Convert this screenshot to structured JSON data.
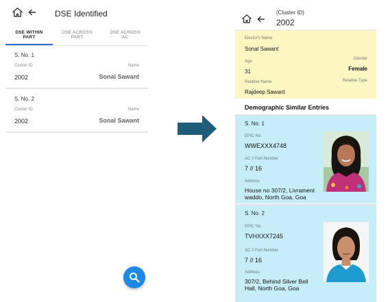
{
  "left": {
    "title": "DSE Identified",
    "tabs": [
      {
        "line1": "DSE WITHIN",
        "line2": "PART",
        "active": true
      },
      {
        "line1": "DSE ACROSS",
        "line2": "PART",
        "active": false
      },
      {
        "line1": "DSE ACROSS",
        "line2": "AC",
        "active": false
      }
    ],
    "records": [
      {
        "sno": "S. No. 1",
        "cluster_label": "Cluster ID",
        "name_label": "Name",
        "cluster_id": "2002",
        "name": "Sonal Sawant"
      },
      {
        "sno": "S. No. 2",
        "cluster_label": "Cluster ID",
        "name_label": "Name",
        "cluster_id": "2002",
        "name": "Sonal Sawant"
      }
    ],
    "fab_icon": "search-icon"
  },
  "arrow": {
    "color": "#1f5c7a"
  },
  "right": {
    "subtitle": "(Cluster ID)",
    "title": "2002",
    "elector": {
      "name_label": "Elector's Name",
      "name": "Sonal Sawant",
      "age_label": "Age",
      "age": "31",
      "gender_label": "Gender",
      "gender": "Female",
      "relative_name_label": "Relative Name",
      "relative_name": "Rajdeep  Sawant",
      "relative_type_label": "Relative Type"
    },
    "section_title": "Demographic Similar Entries",
    "entries": [
      {
        "sno": "S. No. 1",
        "epic_label": "EPIC No.",
        "epic": "WWEXXX4748",
        "ac_label": "AC // Part Number",
        "ac": "7 // 16",
        "address_label": "Address",
        "address_line1": "House no 307/2, Livrament",
        "address_line2": "waddo, North Goa, Goa"
      },
      {
        "sno": "S. No. 2",
        "epic_label": "EPIC No.",
        "epic": "TVHXXX7245",
        "ac_label": "AC // Part Number",
        "ac": "7 // 16",
        "address_label": "Address",
        "address_line1": "307/2, Behind Silver Bell",
        "address_line2": "Hall, North Goa, Goa"
      }
    ]
  },
  "colors": {
    "accent": "#1e88e5",
    "tab_indicator": "#2b6cc4",
    "elector_bg": "#fbf6c2",
    "entry_bg": "#c7eef8"
  }
}
